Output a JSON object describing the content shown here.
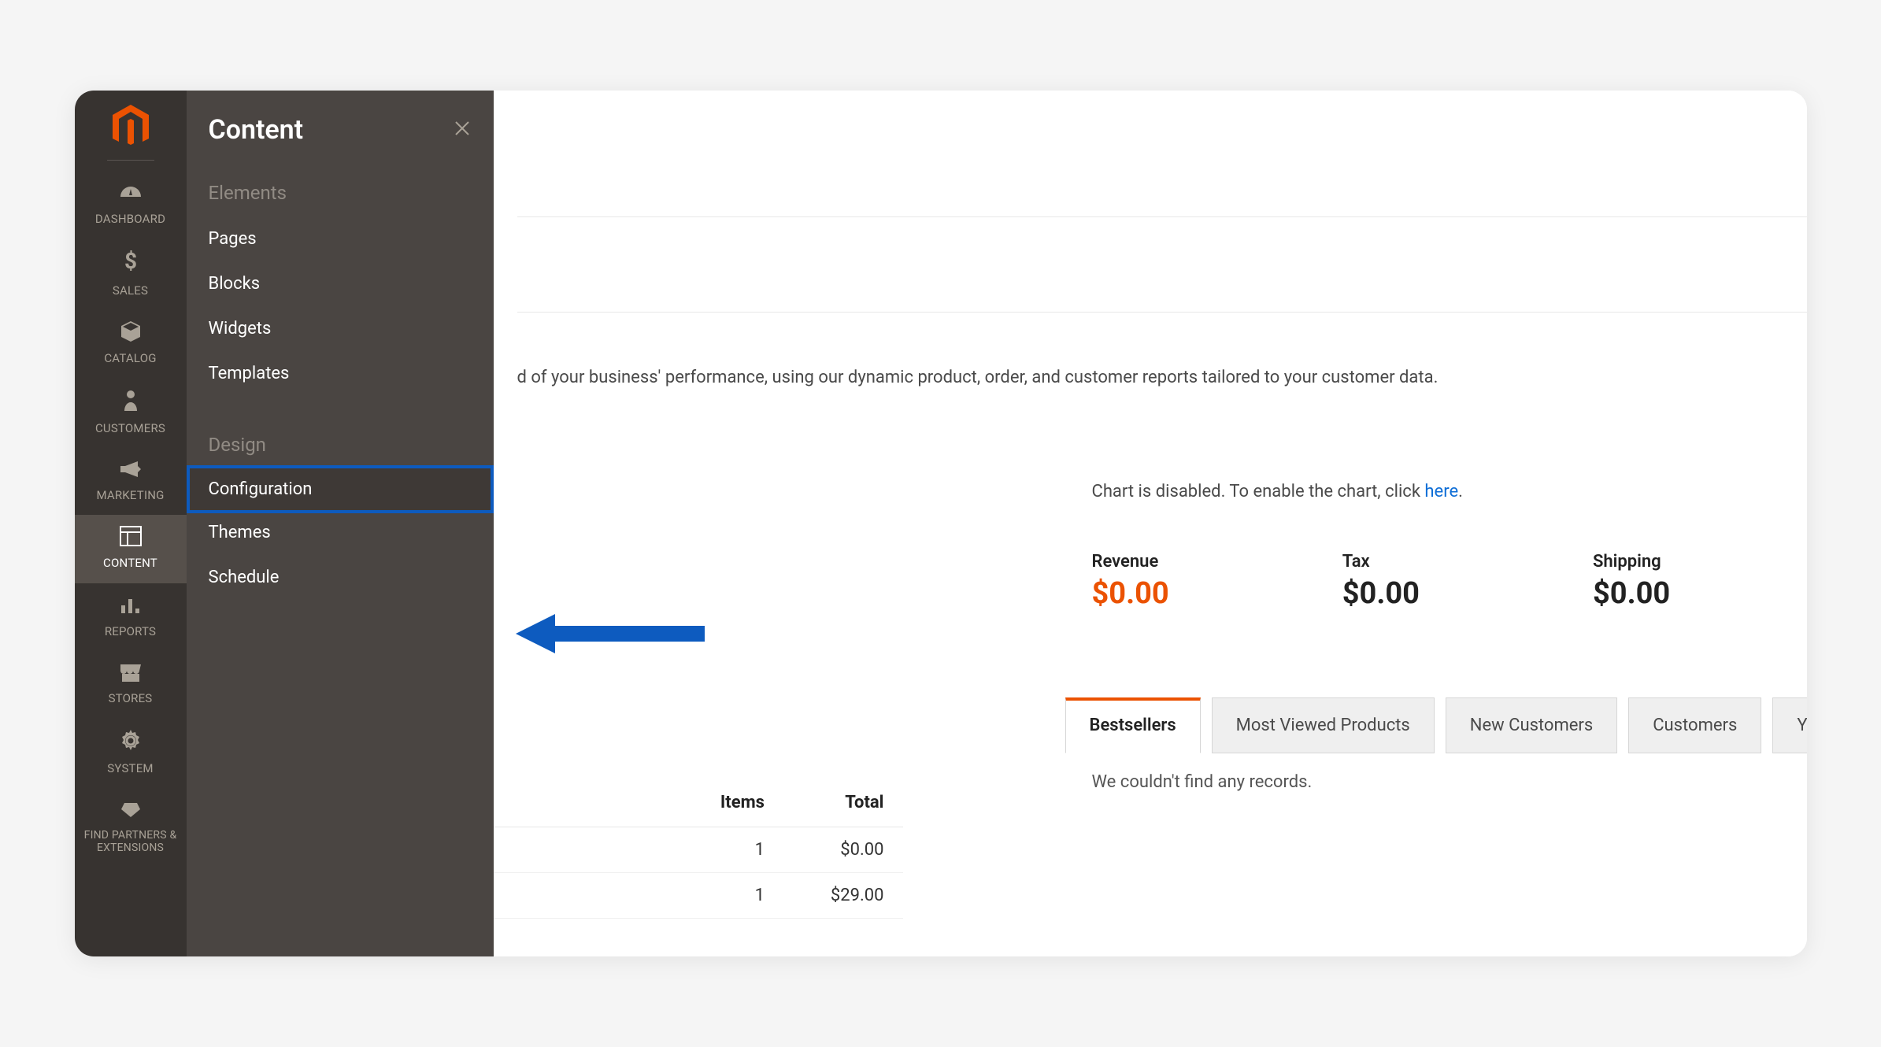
{
  "sidebar": {
    "items": [
      {
        "label": "DASHBOARD"
      },
      {
        "label": "SALES"
      },
      {
        "label": "CATALOG"
      },
      {
        "label": "CUSTOMERS"
      },
      {
        "label": "MARKETING"
      },
      {
        "label": "CONTENT"
      },
      {
        "label": "REPORTS"
      },
      {
        "label": "STORES"
      },
      {
        "label": "SYSTEM"
      },
      {
        "label": "FIND PARTNERS & EXTENSIONS"
      }
    ]
  },
  "flyout": {
    "title": "Content",
    "groups": [
      {
        "title": "Elements",
        "items": [
          {
            "label": "Pages"
          },
          {
            "label": "Blocks"
          },
          {
            "label": "Widgets"
          },
          {
            "label": "Templates"
          }
        ]
      },
      {
        "title": "Design",
        "items": [
          {
            "label": "Configuration"
          },
          {
            "label": "Themes"
          },
          {
            "label": "Schedule"
          }
        ]
      }
    ]
  },
  "main": {
    "info_text_suffix": "d of your business' performance, using our dynamic product, order, and customer reports tailored to your customer data.",
    "chart_note_prefix": "Chart is disabled. To enable the chart, click ",
    "chart_note_link": "here",
    "chart_note_suffix": ".",
    "stats": [
      {
        "label": "Revenue",
        "value": "$0.00"
      },
      {
        "label": "Tax",
        "value": "$0.00"
      },
      {
        "label": "Shipping",
        "value": "$0.00"
      }
    ],
    "tabs": [
      {
        "label": "Bestsellers"
      },
      {
        "label": "Most Viewed Products"
      },
      {
        "label": "New Customers"
      },
      {
        "label": "Customers"
      },
      {
        "label": "Yotpo Reviews"
      }
    ],
    "tab_content_empty": "We couldn't find any records.",
    "table": {
      "headers": [
        "Items",
        "Total"
      ],
      "rows": [
        {
          "items": "1",
          "total": "$0.00"
        },
        {
          "items": "1",
          "total": "$29.00"
        }
      ]
    }
  }
}
